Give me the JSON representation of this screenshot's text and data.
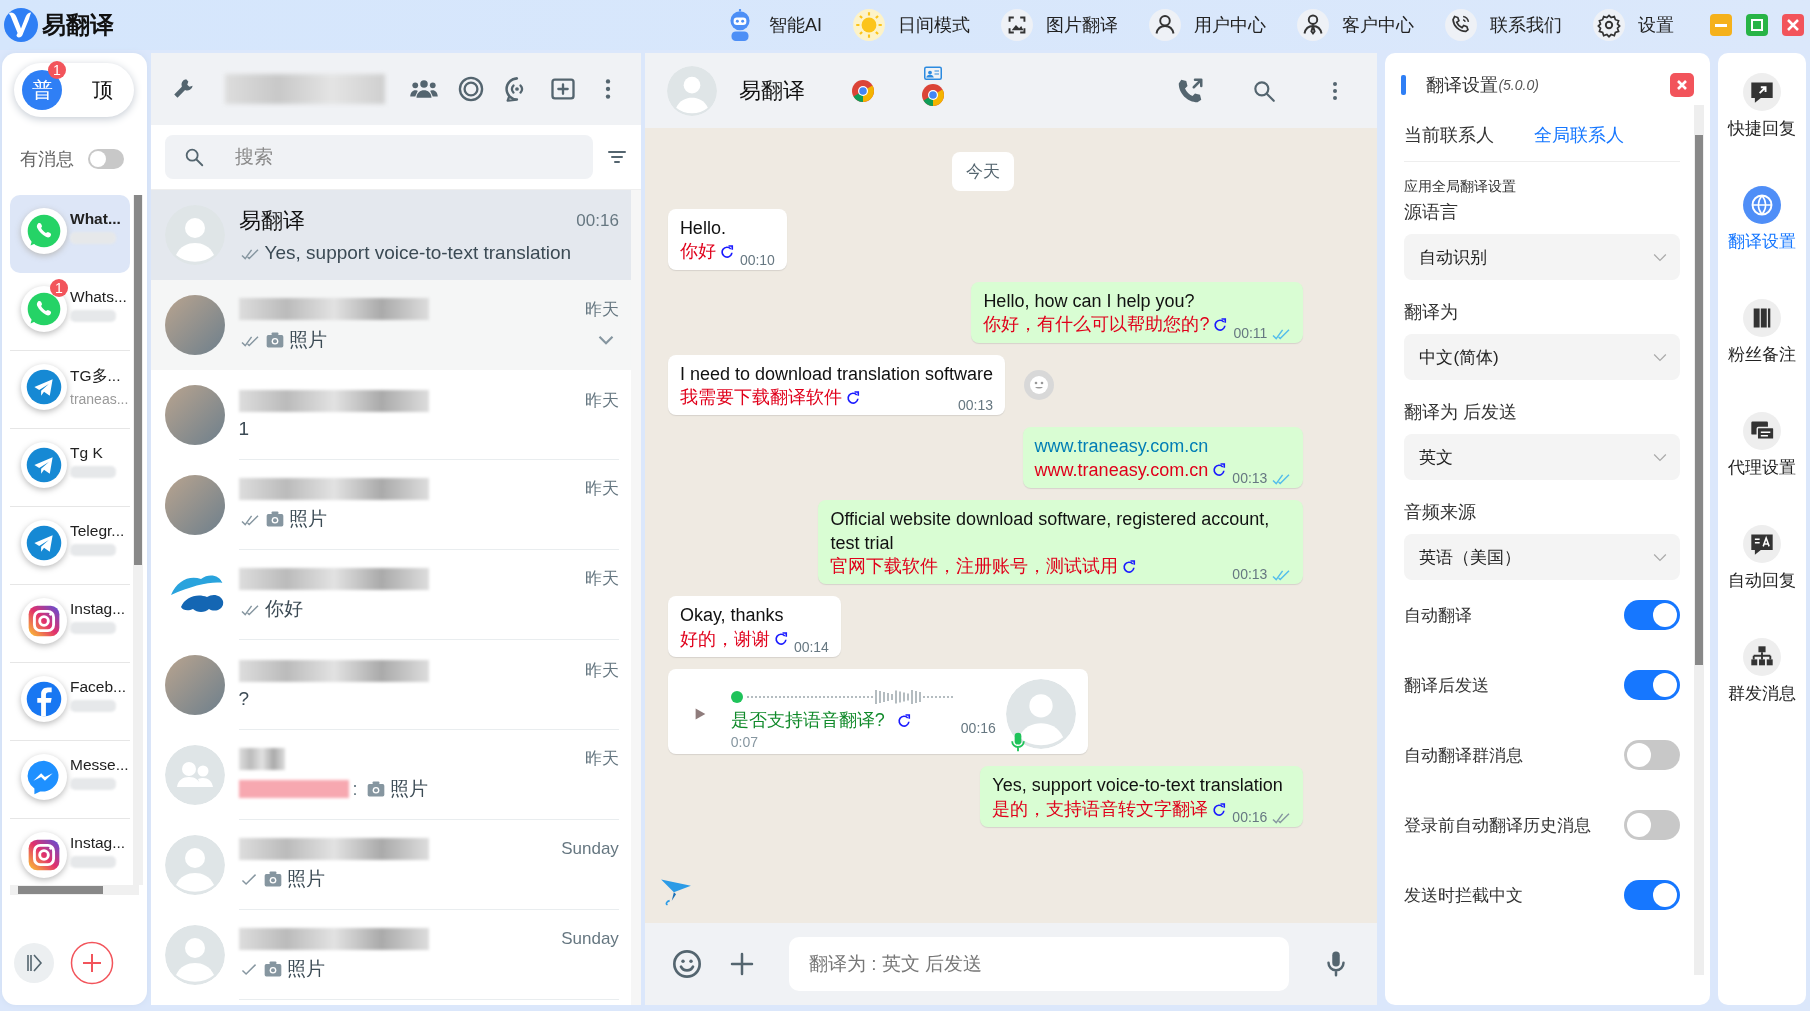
{
  "app": {
    "title": "易翻译"
  },
  "top_menu": [
    {
      "kind": "robot",
      "label": "智能AI"
    },
    {
      "kind": "sun",
      "label": "日间模式"
    },
    {
      "kind": "image",
      "label": "图片翻译"
    },
    {
      "kind": "user",
      "label": "用户中心"
    },
    {
      "kind": "agent",
      "label": "客户中心"
    },
    {
      "kind": "phone",
      "label": "联系我们"
    },
    {
      "kind": "gear",
      "label": "设置"
    }
  ],
  "sidebar": {
    "mode_switch": {
      "options": [
        {
          "label": "普",
          "selected": true
        },
        {
          "label": "顶",
          "selected": false
        }
      ],
      "badge": "1"
    },
    "unread_filter": {
      "label": "有消息",
      "on": false
    },
    "accounts": [
      {
        "kind": "whatsapp",
        "name": "What...",
        "selected": true
      },
      {
        "kind": "whatsapp",
        "name": "Whats...",
        "badge": "1",
        "selected": false
      },
      {
        "kind": "telegram",
        "name": "TG多...",
        "sub": "traneas...",
        "selected": false
      },
      {
        "kind": "telegram",
        "name": "Tg K",
        "selected": false
      },
      {
        "kind": "telegram",
        "name": "Telegr...",
        "selected": false
      },
      {
        "kind": "instagram",
        "name": "Instag...",
        "selected": false
      },
      {
        "kind": "facebook",
        "name": "Faceb...",
        "selected": false
      },
      {
        "kind": "messenger",
        "name": "Messe...",
        "selected": false
      },
      {
        "kind": "instagram",
        "name": "Instag...",
        "selected": false
      }
    ]
  },
  "chat_list": {
    "search": {
      "placeholder": "搜索"
    },
    "chats": [
      {
        "avatar": {
          "kind": "default"
        },
        "name": "易翻译",
        "time": "00:16",
        "ticks": {
          "kind": "double"
        },
        "photo": false,
        "preview": "Yes, support voice-to-text translation",
        "selected": true,
        "hovered": false
      },
      {
        "avatar": {
          "kind": "photo"
        },
        "time": "昨天",
        "ticks": {
          "kind": "double"
        },
        "photo": true,
        "preview": "照片",
        "selected": false,
        "hovered": true
      },
      {
        "avatar": {
          "kind": "photo"
        },
        "time": "昨天",
        "photo": false,
        "preview": "1",
        "selected": false,
        "hovered": false
      },
      {
        "avatar": {
          "kind": "photo"
        },
        "time": "昨天",
        "ticks": {
          "kind": "double"
        },
        "photo": true,
        "preview": "照片",
        "selected": false,
        "hovered": false
      },
      {
        "avatar": {
          "kind": "logo"
        },
        "time": "昨天",
        "ticks": {
          "kind": "double"
        },
        "photo": false,
        "preview": "你好",
        "selected": false,
        "hovered": false
      },
      {
        "avatar": {
          "kind": "photo"
        },
        "time": "昨天",
        "photo": false,
        "preview": "?",
        "selected": false,
        "hovered": false
      },
      {
        "avatar": {
          "kind": "group"
        },
        "time": "昨天",
        "prefix": ":",
        "photo": true,
        "preview": "照片",
        "selected": false,
        "hovered": false
      },
      {
        "avatar": {
          "kind": "default"
        },
        "time": "Sunday",
        "ticks": {
          "kind": "single"
        },
        "photo": true,
        "preview": "照片",
        "selected": false,
        "hovered": false
      },
      {
        "avatar": {
          "kind": "default"
        },
        "time": "Sunday",
        "ticks": {
          "kind": "single"
        },
        "photo": true,
        "preview": "照片",
        "selected": false,
        "hovered": false
      }
    ]
  },
  "chat": {
    "name": "易翻译",
    "date_label": "今天",
    "messages": [
      {
        "kind": "in",
        "text": "Hello.",
        "translation": "你好",
        "time": "00:10"
      },
      {
        "kind": "out",
        "text": "Hello, how can I help you?",
        "translation": "你好，有什么可以帮助您的?",
        "time": "00:11",
        "read": true,
        "link": false
      },
      {
        "kind": "in",
        "text": "I need to download translation software",
        "translation": "我需要下载翻译软件",
        "time": "00:13"
      },
      {
        "kind": "out",
        "text": "www.traneasy.com.cn",
        "translation": "www.traneasy.com.cn",
        "time": "00:13",
        "read": true,
        "link": true
      },
      {
        "kind": "out",
        "text": "Official website download software, registered account, test trial",
        "translation": "官网下载软件，注册账号，测试试用",
        "time": "00:13",
        "read": true,
        "link": false
      },
      {
        "kind": "in",
        "text": "Okay, thanks",
        "translation": "好的，谢谢",
        "time": "00:14"
      },
      {
        "kind": "voice",
        "translation": "是否支持语音翻译?",
        "duration": "0:07",
        "time": "00:16"
      },
      {
        "kind": "out",
        "text": "Yes, support voice-to-text translation",
        "translation": "是的，支持语音转文字翻译",
        "time": "00:16",
        "read": false,
        "link": false
      }
    ],
    "input": {
      "placeholder": "翻译为 : 英文 后发送"
    }
  },
  "translation_settings": {
    "title": "翻译设置",
    "version": "(5.0.0)",
    "tabs": [
      {
        "label": "当前联系人",
        "selected": false
      },
      {
        "label": "全局联系人",
        "selected": true
      }
    ],
    "note": "应用全局翻译设置",
    "selects": [
      {
        "label": "源语言",
        "value": "自动识别"
      },
      {
        "label": "翻译为",
        "value": "中文(简体)"
      },
      {
        "label": "翻译为 后发送",
        "value": "英文"
      },
      {
        "label": "音频来源",
        "value": "英语（美国）"
      }
    ],
    "toggles": [
      {
        "label": "自动翻译",
        "on": true
      },
      {
        "label": "翻译后发送",
        "on": true
      },
      {
        "label": "自动翻译群消息",
        "on": false
      },
      {
        "label": "登录前自动翻译历史消息",
        "on": false
      },
      {
        "label": "发送时拦截中文",
        "on": true
      }
    ]
  },
  "tools": [
    {
      "kind": "quick",
      "label": "快捷回复",
      "selected": false
    },
    {
      "kind": "globe",
      "label": "翻译设置",
      "selected": true
    },
    {
      "kind": "book",
      "label": "粉丝备注",
      "selected": false
    },
    {
      "kind": "proxy",
      "label": "代理设置",
      "selected": false
    },
    {
      "kind": "auto",
      "label": "自动回复",
      "selected": false
    },
    {
      "kind": "broadcast",
      "label": "群发消息",
      "selected": false
    }
  ]
}
